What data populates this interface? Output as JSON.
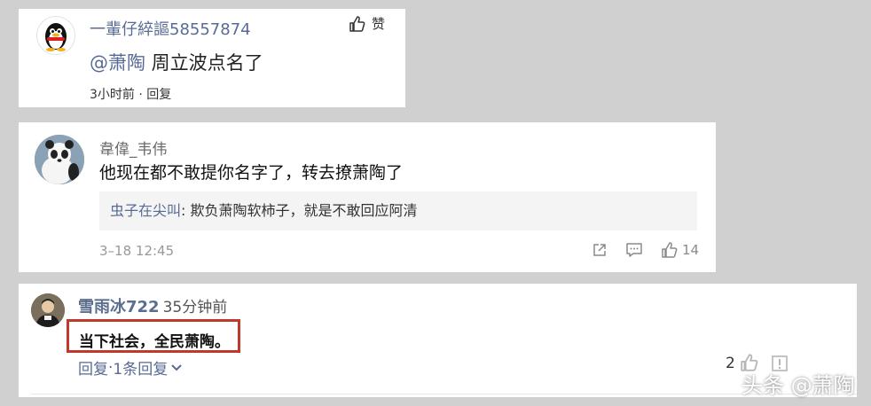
{
  "comment1": {
    "username": "一輩仔綷謳58557874",
    "like_label": "赞",
    "mention": "@萧陶",
    "text": " 周立波点名了",
    "time": "3小时前",
    "sep": " · ",
    "reply_label": "回复"
  },
  "comment2": {
    "username": "韋偉_韦伟",
    "text": "他现在都不敢提你名字了，转去撩萧陶了",
    "quote_name": "虫子在尖叫",
    "quote_text": ": 欺负萧陶软柿子，就是不敢回应阿清",
    "time": "3–18 12:45",
    "like_count": "14"
  },
  "comment3": {
    "username": "雪雨冰722",
    "time_ago": "35分钟前",
    "text": "当下社会，全民萧陶。",
    "reply_label": "回复",
    "sep": " · ",
    "replies_label": "1条回复",
    "like_count": "2"
  },
  "watermark": "头条 @萧陶",
  "colors": {
    "link": "#576b95",
    "highlight_border": "#c0392b",
    "background": "#d0d0d0"
  }
}
